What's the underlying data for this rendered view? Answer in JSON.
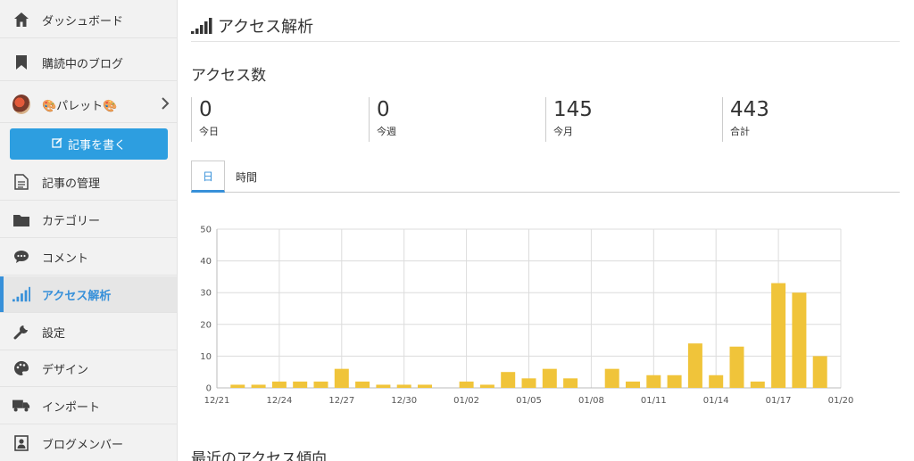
{
  "sidebar": {
    "dashboard": "ダッシュボード",
    "reading": "購読中のブログ",
    "blog_name": "🎨パレット🎨",
    "write_button": "記事を書く",
    "manage": "記事の管理",
    "category": "カテゴリー",
    "comment": "コメント",
    "analytics": "アクセス解析",
    "settings": "設定",
    "design": "デザイン",
    "import": "インポート",
    "members": "ブログメンバー"
  },
  "header": {
    "title": "アクセス解析"
  },
  "access": {
    "title": "アクセス数",
    "stats": [
      {
        "value": "0",
        "label": "今日"
      },
      {
        "value": "0",
        "label": "今週"
      },
      {
        "value": "145",
        "label": "今月"
      },
      {
        "value": "443",
        "label": "合計"
      }
    ]
  },
  "tabs": {
    "day": "日",
    "hour": "時間"
  },
  "chart_data": {
    "type": "bar",
    "categories": [
      "12/21",
      "12/22",
      "12/23",
      "12/24",
      "12/25",
      "12/26",
      "12/27",
      "12/28",
      "12/29",
      "12/30",
      "12/31",
      "01/01",
      "01/02",
      "01/03",
      "01/04",
      "01/05",
      "01/06",
      "01/07",
      "01/08",
      "01/09",
      "01/10",
      "01/11",
      "01/12",
      "01/13",
      "01/14",
      "01/15",
      "01/16",
      "01/17",
      "01/18",
      "01/19",
      "01/20"
    ],
    "values": [
      0,
      1,
      1,
      2,
      2,
      2,
      6,
      2,
      1,
      1,
      1,
      0,
      2,
      1,
      5,
      3,
      6,
      3,
      0,
      6,
      2,
      4,
      4,
      14,
      4,
      13,
      2,
      33,
      30,
      10,
      0
    ],
    "tick_labels": [
      "12/21",
      "12/24",
      "12/27",
      "12/30",
      "01/02",
      "01/05",
      "01/08",
      "01/11",
      "01/14",
      "01/17",
      "01/20"
    ],
    "yticks": [
      0,
      10,
      20,
      30,
      40,
      50
    ],
    "ylim": [
      0,
      50
    ],
    "grid": true,
    "color": "#f0c43a"
  },
  "recent": {
    "title": "最近のアクセス傾向"
  },
  "colors": {
    "accent": "#3790d9",
    "button": "#2d9ee0",
    "bar": "#f0c43a"
  }
}
